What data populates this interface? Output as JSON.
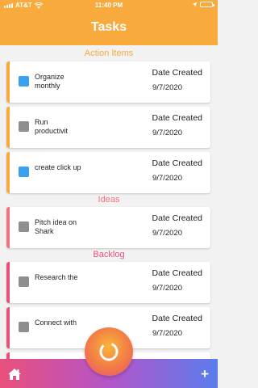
{
  "status_bar": {
    "carrier": "AT&T",
    "time": "11:40 PM"
  },
  "header": {
    "title": "Tasks",
    "background": "#f8aa3c"
  },
  "sections": [
    {
      "title": "Action Items",
      "color": "#f8aa3c",
      "cards": [
        {
          "title": "Organize monthly",
          "date_label": "Date Created",
          "date": "9/7/2020",
          "checkbox_color": "#3aa0f0"
        },
        {
          "title": "Run productivit",
          "date_label": "Date Created",
          "date": "9/7/2020",
          "checkbox_color": "#8e8e8e"
        },
        {
          "title": "create click up",
          "date_label": "Date Created",
          "date": "9/7/2020",
          "checkbox_color": "#3aa0f0"
        }
      ]
    },
    {
      "title": "Ideas",
      "color": "#ee7580",
      "cards": [
        {
          "title": "Pitch idea on Shark",
          "date_label": "Date Created",
          "date": "9/7/2020",
          "checkbox_color": "#8e8e8e"
        }
      ]
    },
    {
      "title": "Backlog",
      "color": "#e9507a",
      "cards": [
        {
          "title": "Research the",
          "date_label": "Date Created",
          "date": "9/7/2020",
          "checkbox_color": "#8e8e8e"
        },
        {
          "title": "Connect with",
          "date_label": "Date Created",
          "date": "9/7/2020",
          "checkbox_color": "#8e8e8e"
        }
      ]
    }
  ],
  "bottom_bar": {
    "left_icon": "home-icon",
    "center_icon": "refresh-ring-icon",
    "right_label": "+"
  }
}
